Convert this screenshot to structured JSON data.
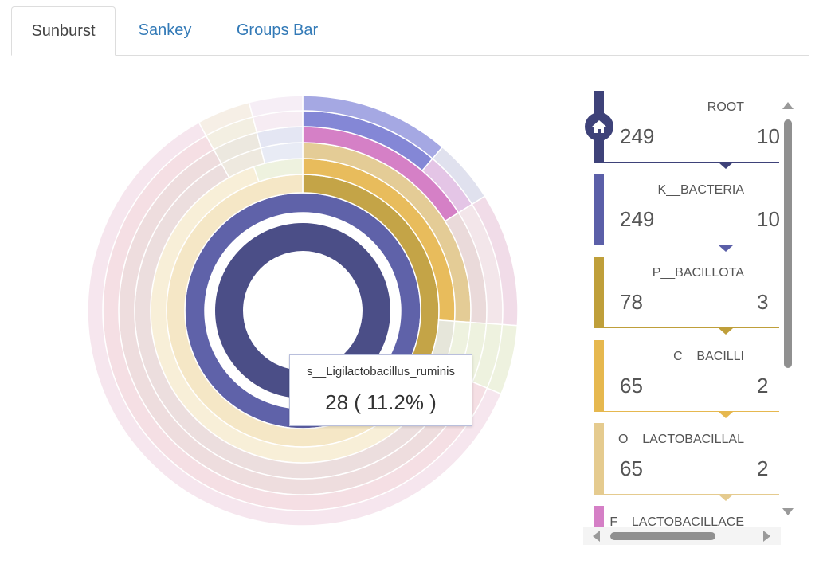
{
  "tabs": [
    {
      "label": "Sunburst",
      "active": true
    },
    {
      "label": "Sankey",
      "active": false
    },
    {
      "label": "Groups Bar",
      "active": false
    }
  ],
  "tooltip": {
    "name": "s__Ligilactobacillus_ruminis",
    "value": "28 ( 11.2% )"
  },
  "legend": {
    "cards": [
      {
        "name": "ROOT",
        "count": "249",
        "pct": "10",
        "color": "#3e4279",
        "home": true
      },
      {
        "name": "K__BACTERIA",
        "count": "249",
        "pct": "10",
        "color": "#5b5fa8"
      },
      {
        "name": "P__BACILLOTA",
        "count": "78",
        "pct": "3",
        "color": "#bf9f3a"
      },
      {
        "name": "C__BACILLI",
        "count": "65",
        "pct": "2",
        "color": "#e6b84f"
      },
      {
        "name": "O__LACTOBACILLAL",
        "count": "65",
        "pct": "2",
        "color": "#e5cb8f"
      },
      {
        "name": "F__LACTOBACILLACE",
        "count": "",
        "pct": "",
        "color": "#d57fc6"
      }
    ]
  },
  "chart_data": {
    "type": "sunburst",
    "total": 249,
    "rings": [
      {
        "level": "root",
        "segments": [
          {
            "name": "ROOT",
            "value": 249,
            "color": "#4b4e87",
            "faded": false
          }
        ]
      },
      {
        "level": "kingdom",
        "segments": [
          {
            "name": "K__BACTERIA",
            "value": 249,
            "color": "#5f62a9",
            "faded": false
          }
        ]
      },
      {
        "level": "phylum",
        "segments": [
          {
            "value": 78,
            "color": "#c4a447",
            "faded": false
          },
          {
            "value": 171,
            "color": "#f5e7c6",
            "faded": true
          }
        ]
      },
      {
        "level": "class",
        "segments": [
          {
            "value": 65,
            "color": "#e8bc5c",
            "faded": false
          },
          {
            "value": 13,
            "color": "#e6e6da",
            "faded": true
          },
          {
            "value": 158,
            "color": "#f8efd8",
            "faded": true
          },
          {
            "value": 13,
            "color": "#eef2df",
            "faded": true
          }
        ]
      },
      {
        "level": "order",
        "segments": [
          {
            "value": 65,
            "color": "#e4cc96",
            "faded": false
          },
          {
            "value": 13,
            "color": "#eef2df",
            "faded": true
          },
          {
            "value": 151,
            "color": "#ecdede",
            "faded": true
          },
          {
            "value": 10,
            "color": "#eee9df",
            "faded": true
          },
          {
            "value": 10,
            "color": "#e8ebf5",
            "faded": true
          }
        ]
      },
      {
        "level": "family",
        "segments": [
          {
            "name": "F__LACTOBACILLACEAE",
            "value": 40,
            "color": "#d580c6",
            "faded": false
          },
          {
            "value": 25,
            "color": "#eadada",
            "faded": true
          },
          {
            "value": 13,
            "color": "#eef2df",
            "faded": true
          },
          {
            "value": 151,
            "color": "#eeddde",
            "faded": true
          },
          {
            "value": 10,
            "color": "#ece8df",
            "faded": true
          },
          {
            "value": 10,
            "color": "#e4e6f3",
            "faded": true
          }
        ]
      },
      {
        "level": "genus",
        "segments": [
          {
            "value": 28,
            "color": "#8487d6",
            "faded": false
          },
          {
            "value": 12,
            "color": "#e4c5e6",
            "faded": true
          },
          {
            "value": 25,
            "color": "#f3e6ea",
            "faded": true
          },
          {
            "value": 13,
            "color": "#eef2df",
            "faded": true
          },
          {
            "value": 151,
            "color": "#f5dfe4",
            "faded": true
          },
          {
            "value": 10,
            "color": "#f3efe2",
            "faded": true
          },
          {
            "value": 10,
            "color": "#f6ecf3",
            "faded": true
          }
        ]
      },
      {
        "level": "species",
        "segments": [
          {
            "name": "s__Ligilactobacillus_ruminis",
            "value": 28,
            "color": "#a5a8e3",
            "faded": false
          },
          {
            "value": 12,
            "color": "#e0e1ee",
            "faded": true
          },
          {
            "value": 25,
            "color": "#f1dce8",
            "faded": true
          },
          {
            "value": 13,
            "color": "#eef2df",
            "faded": true
          },
          {
            "value": 151,
            "color": "#f6e6ee",
            "faded": true
          },
          {
            "value": 10,
            "color": "#f6efe6",
            "faded": true
          },
          {
            "value": 10,
            "color": "#f6eef6",
            "faded": true
          }
        ]
      }
    ]
  }
}
